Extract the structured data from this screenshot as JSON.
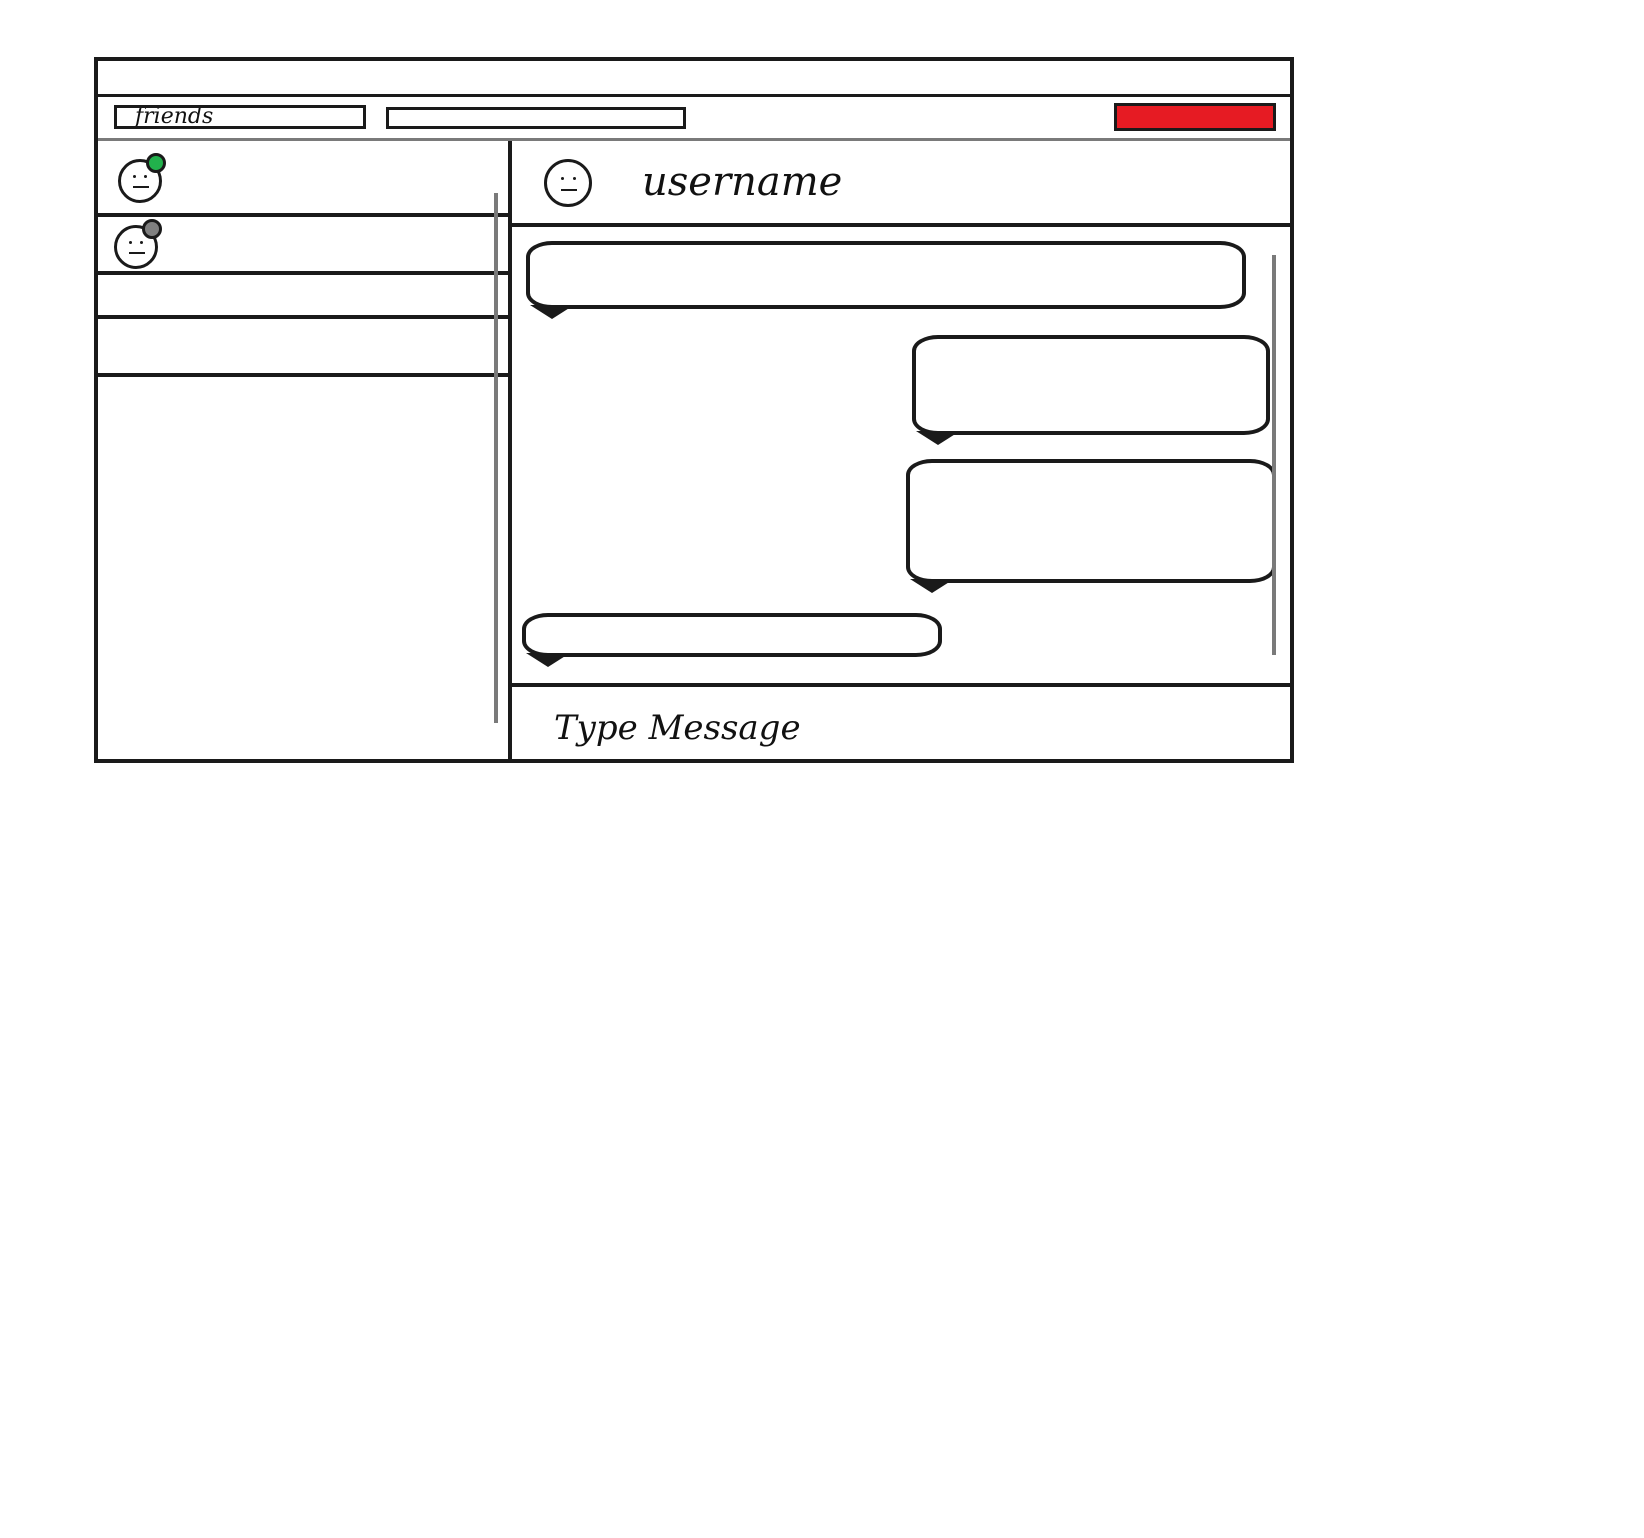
{
  "toolbar": {
    "friends_label": "friends"
  },
  "chat": {
    "username": "username"
  },
  "composer": {
    "placeholder": "Type Message"
  },
  "colors": {
    "online": "#22b14c",
    "offline": "#7f7f7f",
    "accent": "#e61b23"
  }
}
